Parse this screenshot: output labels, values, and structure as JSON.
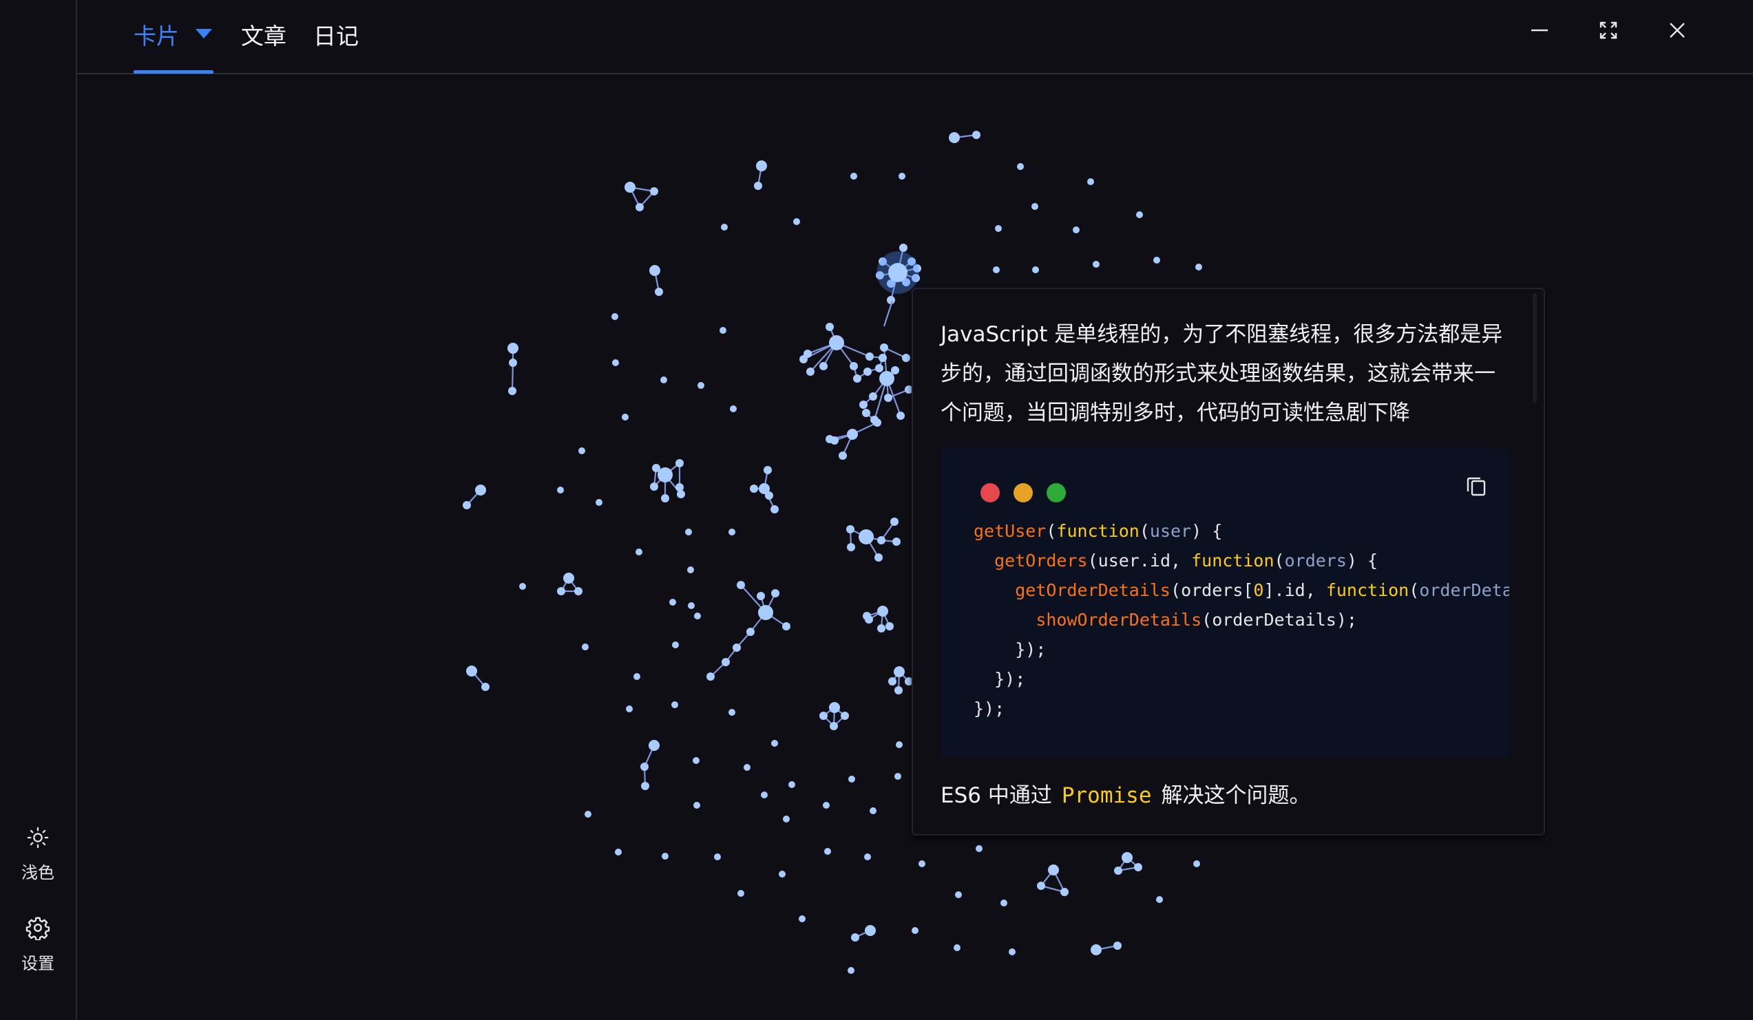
{
  "sidebar": {
    "theme_label": "浅色",
    "settings_label": "设置"
  },
  "tabs": {
    "cards": "卡片",
    "articles": "文章",
    "diary": "日记"
  },
  "window_controls": [
    "minimize",
    "maximize",
    "close"
  ],
  "card": {
    "intro": "JavaScript 是单线程的，为了不阻塞线程，很多方法都是异步的，通过回调函数的形式来处理函数结果，这就会带来一个问题，当回调特别多时，代码的可读性急剧下降",
    "code": {
      "line1": {
        "fn": "getUser",
        "kw": "function",
        "param": "user"
      },
      "line2": {
        "fn": "getOrders",
        "arg": "user.id",
        "kw": "function",
        "param": "orders"
      },
      "line3": {
        "fn": "getOrderDetails",
        "arg_pre": "orders[",
        "num": "0",
        "arg_post": "].id",
        "kw": "function",
        "param": "orderDetail"
      },
      "line4": {
        "fn": "showOrderDetails",
        "arg": "orderDetails"
      }
    },
    "footer_pre": "ES6 中通过",
    "footer_highlight": "Promise",
    "footer_post": "解决这个问题。"
  },
  "colors": {
    "accent": "#3b82f6",
    "node": "#a9ccff",
    "edge": "#7e95d9",
    "background": "#0f0e15"
  },
  "icons": [
    "sun-icon",
    "gear-icon",
    "minimize-icon",
    "maximize-icon",
    "close-icon",
    "copy-icon",
    "caret-down-icon"
  ]
}
